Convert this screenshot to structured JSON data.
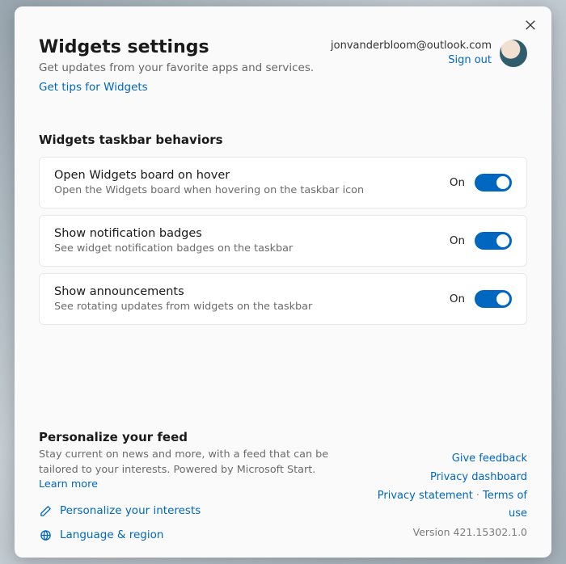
{
  "header": {
    "title": "Widgets settings",
    "subtitle": "Get updates from your favorite apps and services.",
    "tips_link": "Get tips for Widgets"
  },
  "account": {
    "email": "jonvanderbloom@outlook.com",
    "sign_out": "Sign out"
  },
  "taskbar": {
    "section_title": "Widgets taskbar behaviors",
    "items": [
      {
        "title": "Open Widgets board on hover",
        "desc": "Open the Widgets board when hovering on the taskbar icon",
        "state": "On"
      },
      {
        "title": "Show notification badges",
        "desc": "See widget notification badges on the taskbar",
        "state": "On"
      },
      {
        "title": "Show announcements",
        "desc": "See rotating updates from widgets on the taskbar",
        "state": "On"
      }
    ]
  },
  "personalize": {
    "title": "Personalize your feed",
    "desc": "Stay current on news and more, with a feed that can be tailored to your interests. Powered by Microsoft Start. ",
    "learn_more": "Learn more",
    "link_interests": "Personalize your interests",
    "link_language": "Language & region"
  },
  "footer_links": {
    "feedback": "Give feedback",
    "privacy_dashboard": "Privacy dashboard",
    "privacy_statement": "Privacy statement",
    "terms": "Terms of use",
    "version": "Version 421.15302.1.0"
  }
}
